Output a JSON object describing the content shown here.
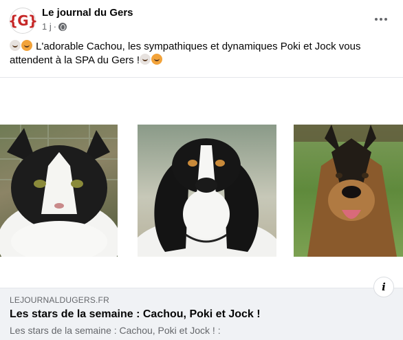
{
  "header": {
    "avatar_glyph": "{G}",
    "page_name": "Le journal du Gers",
    "time": "1 j",
    "separator": "·",
    "more_icon": "more-dots-icon",
    "privacy_icon": "globe-icon"
  },
  "post": {
    "line1": "L'adorable Cachou, les sympathiques et dynamiques Poki et Jock vous",
    "line2": "attendent à la SPA du Gers !"
  },
  "media": {
    "photos": [
      "cat-photo",
      "hound-photo",
      "shepherd-photo"
    ]
  },
  "link": {
    "domain": "LEJOURNALDUGERS.FR",
    "title": "Les stars de la semaine : Cachou, Poki et Jock !",
    "description": "Les stars de la semaine : Cachou, Poki et Jock ! :",
    "info_glyph": "i"
  }
}
